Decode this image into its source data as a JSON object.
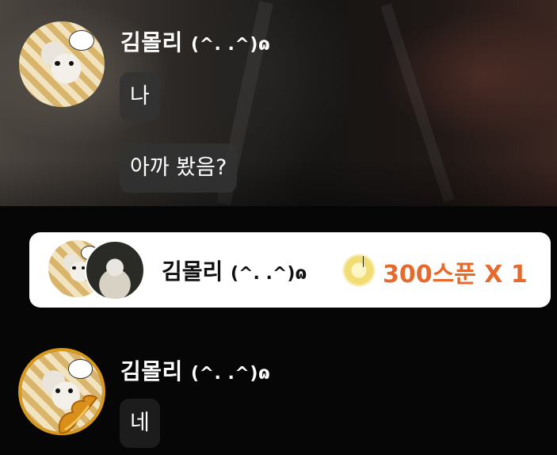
{
  "messages": [
    {
      "user": "김몰리",
      "user_deco": "(^. .^)ɷ",
      "lines": [
        "나",
        "아까 봤음?"
      ]
    },
    {
      "user": "김몰리",
      "user_deco": "(^. .^)ɷ",
      "lines": [
        "네"
      ]
    }
  ],
  "gift": {
    "user": "김몰리",
    "user_deco": "(^. .^)ɷ",
    "amount": "300스푼 X 1"
  },
  "colors": {
    "gift_amount": "#e66a2c",
    "gold_ring": "#d99a1c"
  },
  "icons": [
    "rat-avatar",
    "spoon-icon",
    "wing-badge-icon"
  ]
}
